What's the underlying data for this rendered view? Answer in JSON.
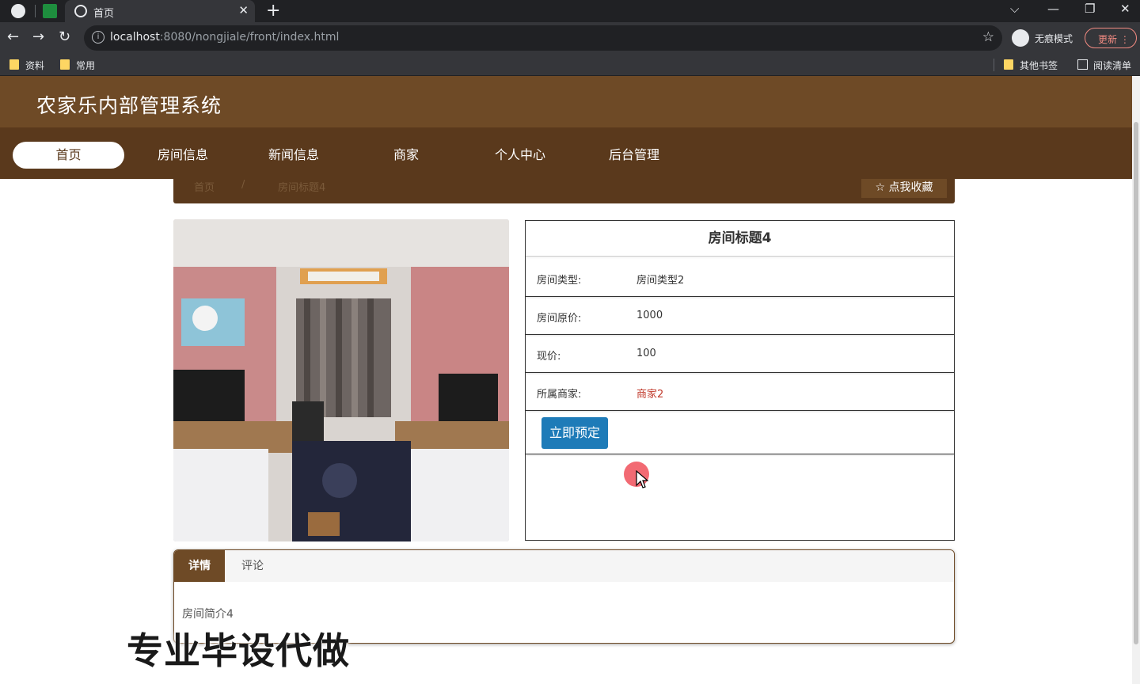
{
  "browser": {
    "tab_title": "首页",
    "new_tab_symbol": "+",
    "url_host": "localhost",
    "url_rest": ":8080/nongjiale/front/index.html",
    "profile_label": "无痕模式",
    "update_label": "更新",
    "bookmarks": [
      "资料",
      "常用"
    ],
    "bookmarks_right": [
      "其他书签",
      "阅读清单"
    ]
  },
  "site": {
    "title": "农家乐内部管理系统",
    "nav": [
      "首页",
      "房间信息",
      "新闻信息",
      "商家",
      "个人中心",
      "后台管理"
    ]
  },
  "breadcrumb": {
    "home": "首页",
    "separator": "/",
    "current": "房间标题4",
    "favorite_label": "☆ 点我收藏"
  },
  "room": {
    "title": "房间标题4",
    "fields": [
      {
        "label": "房间类型:",
        "value": "房间类型2"
      },
      {
        "label": "房间原价:",
        "value": "1000"
      },
      {
        "label": "现价:",
        "value": "100"
      },
      {
        "label": "所属商家:",
        "value": "商家2"
      }
    ],
    "book_label": "立即预定"
  },
  "tabs": {
    "items": [
      "详情",
      "评论"
    ],
    "content": "房间简介4"
  },
  "watermark": "专业毕设代做",
  "colors": {
    "header": "#6e4a26",
    "nav": "#5a391c",
    "book_button": "#1e7bb8",
    "merchant_link": "#c0392b"
  }
}
